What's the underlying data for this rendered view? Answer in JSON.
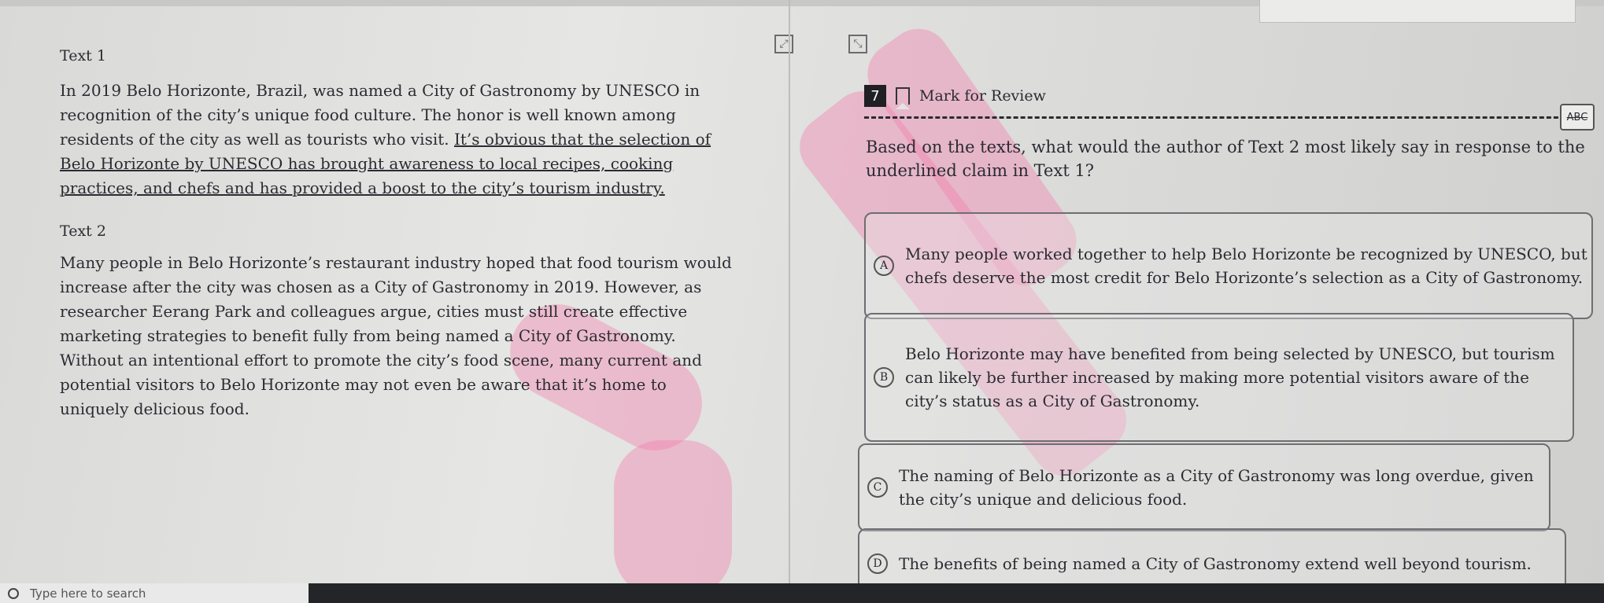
{
  "toolbar": {
    "expand_icon": "expand-icon",
    "collapse_icon": "collapse-icon"
  },
  "passages": {
    "text1_title": "Text 1",
    "text1_before": "In 2019 Belo Horizonte, Brazil, was named a City of Gastronomy by UNESCO in recognition of the city’s unique food culture. The honor is well known among residents of the city as well as tourists who visit. ",
    "text1_underlined": "It’s obvious that the selection of Belo Horizonte by UNESCO has brought awareness to local recipes, cooking practices, and chefs and has provided a boost to the city’s tourism industry.",
    "text2_title": "Text 2",
    "text2_body": "Many people in Belo Horizonte’s restaurant industry hoped that food tourism would increase after the city was chosen as a City of Gastronomy in 2019. However, as researcher Eerang Park and colleagues argue, cities must still create effective marketing strategies to benefit fully from being named a City of Gastronomy. Without an intentional effort to promote the city’s food scene, many current and potential visitors to Belo Horizonte may not even be aware that it’s home to uniquely delicious food."
  },
  "question": {
    "number": "7",
    "mark_for_review": "Mark for Review",
    "abc_label": "ABC",
    "prompt": "Based on the texts, what would the author of Text 2 most likely say in response to the underlined claim in Text 1?",
    "options": [
      {
        "letter": "A",
        "text": "Many people worked together to help Belo Horizonte be recognized by UNESCO, but chefs deserve the most credit for Belo Horizonte’s selection as a City of Gastronomy."
      },
      {
        "letter": "B",
        "text": "Belo Horizonte may have benefited from being selected by UNESCO, but tourism can likely be further increased by making more potential visitors aware of the city’s status as a City of Gastronomy."
      },
      {
        "letter": "C",
        "text": "The naming of Belo Horizonte as a City of Gastronomy was long overdue, given the city’s unique and delicious food."
      },
      {
        "letter": "D",
        "text": "The benefits of being named a City of Gastronomy extend well beyond tourism."
      }
    ]
  },
  "taskbar": {
    "search_placeholder": "Type here to search"
  }
}
